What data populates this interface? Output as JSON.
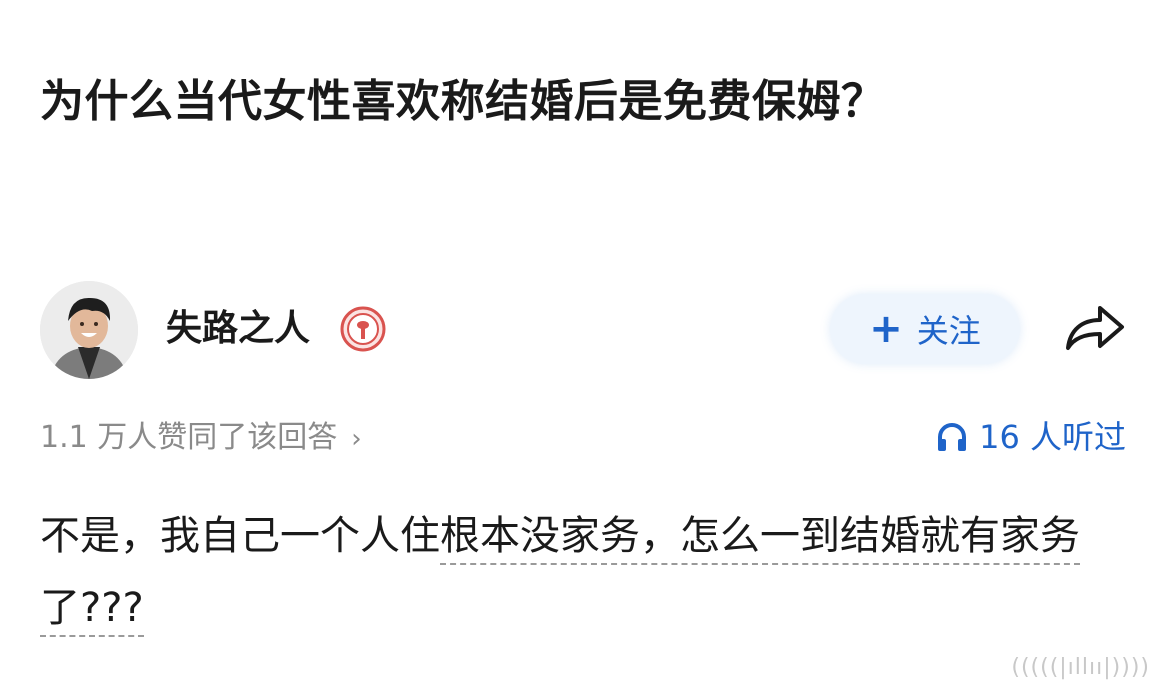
{
  "question": {
    "title": "为什么当代女性喜欢称结婚后是免费保姆？"
  },
  "author": {
    "name": "失路之人",
    "avatar_icon": "avatar-photo",
    "badge_icon": "badge-icon",
    "badge_color": "#d9534f"
  },
  "actions": {
    "follow_label": "关注",
    "follow_icon": "plus-icon",
    "share_icon": "share-arrow-icon",
    "accent_color": "#1f64c9"
  },
  "stats": {
    "approve_text": "1.1 万人赞同了该回答",
    "approve_chevron": "›",
    "listen_text": "16 人听过",
    "listen_icon": "headphones-icon"
  },
  "answer": {
    "text_plain": "不是，我自己一个人住",
    "text_underlined_1": "根本没家务，怎么一到结婚就有家务了???"
  },
  "watermark": {
    "text": "(((((|ıllıı|))))"
  }
}
